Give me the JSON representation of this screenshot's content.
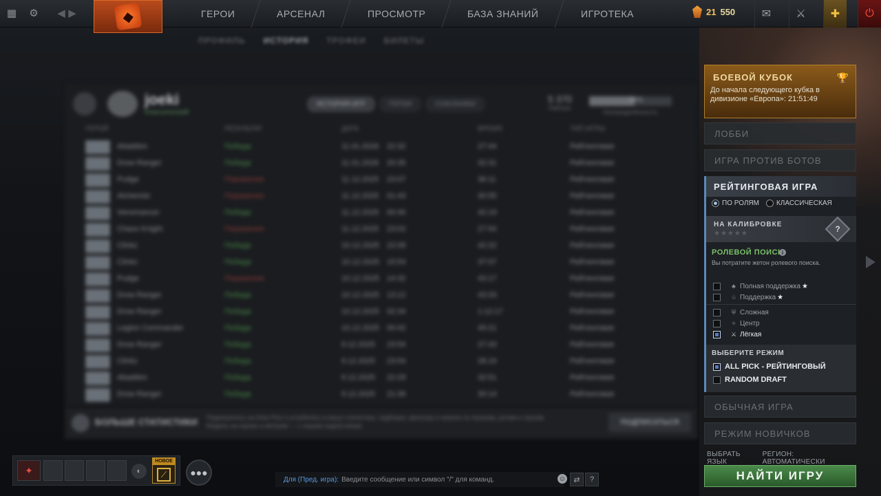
{
  "topbar": {
    "nav": [
      "ГЕРОИ",
      "АРСЕНАЛ",
      "ПРОСМОТР",
      "БАЗА ЗНАНИЙ",
      "ИГРОТЕКА"
    ],
    "level": "21",
    "shards": "550"
  },
  "subnav": [
    "ПРОФИЛЬ",
    "ИСТОРИЯ",
    "ТРОФЕИ",
    "БИЛЕТЫ"
  ],
  "profile": {
    "name": "joeki",
    "status": "Классический",
    "tabs": [
      "ИСТОРИЯ ИГР",
      "ГЕРОИ",
      "СОЮЗНИКИ"
    ],
    "stat_value": "5 370",
    "stat_label": "Рейтинг",
    "bar_label": "Неопределённость",
    "bar_pct": "38%"
  },
  "table": {
    "columns": [
      "ГЕРОЙ",
      "РЕЗУЛЬТАТ",
      "ДАТА",
      "ВРЕМЯ",
      "ТИП ИГРЫ"
    ],
    "rows": [
      {
        "hero": "Abaddon",
        "result": "Победа",
        "win": true,
        "date": "11.01.2026",
        "time": "22:32",
        "dur": "27:44",
        "type": "Рейтинговая"
      },
      {
        "hero": "Drow Ranger",
        "result": "Победа",
        "win": true,
        "date": "11.01.2026",
        "time": "20:35",
        "dur": "32:31",
        "type": "Рейтинговая"
      },
      {
        "hero": "Pudge",
        "result": "Поражение",
        "win": false,
        "date": "11.12.2025",
        "time": "23:07",
        "dur": "36:11",
        "type": "Рейтинговая"
      },
      {
        "hero": "Alchemist",
        "result": "Поражение",
        "win": false,
        "date": "11.12.2025",
        "time": "01:43",
        "dur": "30:55",
        "type": "Рейтинговая"
      },
      {
        "hero": "Venomancer",
        "result": "Победа",
        "win": true,
        "date": "11.12.2025",
        "time": "00:40",
        "dur": "42:19",
        "type": "Рейтинговая"
      },
      {
        "hero": "Chaos Knight",
        "result": "Поражение",
        "win": false,
        "date": "11.12.2025",
        "time": "23:02",
        "dur": "27:54",
        "type": "Рейтинговая"
      },
      {
        "hero": "Clinkz",
        "result": "Победа",
        "win": true,
        "date": "10.12.2025",
        "time": "22:09",
        "dur": "42:22",
        "type": "Рейтинговая"
      },
      {
        "hero": "Clinkz",
        "result": "Победа",
        "win": true,
        "date": "10.12.2025",
        "time": "15:54",
        "dur": "37:07",
        "type": "Рейтинговая"
      },
      {
        "hero": "Pudge",
        "result": "Поражение",
        "win": false,
        "date": "10.12.2025",
        "time": "14:32",
        "dur": "43:17",
        "type": "Рейтинговая"
      },
      {
        "hero": "Drow Ranger",
        "result": "Победа",
        "win": true,
        "date": "10.12.2025",
        "time": "13:12",
        "dur": "43:33",
        "type": "Рейтинговая"
      },
      {
        "hero": "Drow Ranger",
        "result": "Победа",
        "win": true,
        "date": "10.12.2025",
        "time": "02:34",
        "dur": "1:12:17",
        "type": "Рейтинговая"
      },
      {
        "hero": "Legion Commander",
        "result": "Победа",
        "win": true,
        "date": "10.12.2025",
        "time": "00:42",
        "dur": "45:21",
        "type": "Рейтинговая"
      },
      {
        "hero": "Drow Ranger",
        "result": "Победа",
        "win": true,
        "date": "9.12.2025",
        "time": "23:54",
        "dur": "27:43",
        "type": "Рейтинговая"
      },
      {
        "hero": "Clinkz",
        "result": "Победа",
        "win": true,
        "date": "9.12.2025",
        "time": "23:54",
        "dur": "28:19",
        "type": "Рейтинговая"
      },
      {
        "hero": "Abaddon",
        "result": "Победа",
        "win": true,
        "date": "9.12.2025",
        "time": "22:29",
        "dur": "32:51",
        "type": "Рейтинговая"
      },
      {
        "hero": "Drow Ranger",
        "result": "Победа",
        "win": true,
        "date": "9.12.2025",
        "time": "21:36",
        "dur": "30:14",
        "type": "Рейтинговая"
      }
    ]
  },
  "promo": {
    "title": "БОЛЬШЕ СТАТИСТИКИ",
    "text": "Подпишитесь на Dota Plus и углубитесь в вашу статистику: подборки, фильтры и анализ по игрокам, ролям и героям. Модель на героях и метрике — с нашим подписчикам.",
    "button": "ПОДПИСАТЬСЯ"
  },
  "party": {
    "new_label": "НОВОЕ"
  },
  "chat": {
    "channel": "Для (Пред. игра):",
    "placeholder": "Введите сообщение или символ \"/\" для команд."
  },
  "right": {
    "battle_cup_title": "БОЕВОЙ КУБОК",
    "battle_cup_text": "До начала следующего кубка в дивизионе «Европа»: 21:51:49",
    "lobby": "ЛОББИ",
    "bots": "ИГРА ПРОТИВ БОТОВ",
    "ranked": "РЕЙТИНГОВАЯ ИГРА",
    "radio": {
      "roles": "ПО РОЛЯМ",
      "classic": "КЛАССИЧЕСКАЯ"
    },
    "calibration": "НА КАЛИБРОВКЕ",
    "calib_stars": "★★★★★",
    "role_search": "РОЛЕВОЙ ПОИСК",
    "role_desc": "Вы потратите жетон ролевого поиска.",
    "roles": [
      {
        "label": "Полная поддержка",
        "star": true,
        "checked": false
      },
      {
        "label": "Поддержка",
        "star": true,
        "checked": false
      },
      {
        "label": "Сложная",
        "star": false,
        "checked": false
      },
      {
        "label": "Центр",
        "star": false,
        "checked": false
      },
      {
        "label": "Лёгкая",
        "star": false,
        "checked": true
      }
    ],
    "select_mode": "ВЫБЕРИТЕ РЕЖИМ",
    "mode_allpick": "ALL PICK - РЕЙТИНГОВЫЙ",
    "mode_random": "RANDOM DRAFT",
    "normal": "ОБЫЧНАЯ ИГРА",
    "newbie": "РЕЖИМ НОВИЧКОВ",
    "language": "ВЫБРАТЬ ЯЗЫК",
    "region": "РЕГИОН: АВТОМАТИЧЕСКИ",
    "find": "НАЙТИ ИГРУ"
  },
  "colors": {
    "accent_green": "#4a8a4a",
    "battle_cup": "#8a5a1a",
    "ranked_border": "#5a8aba"
  }
}
